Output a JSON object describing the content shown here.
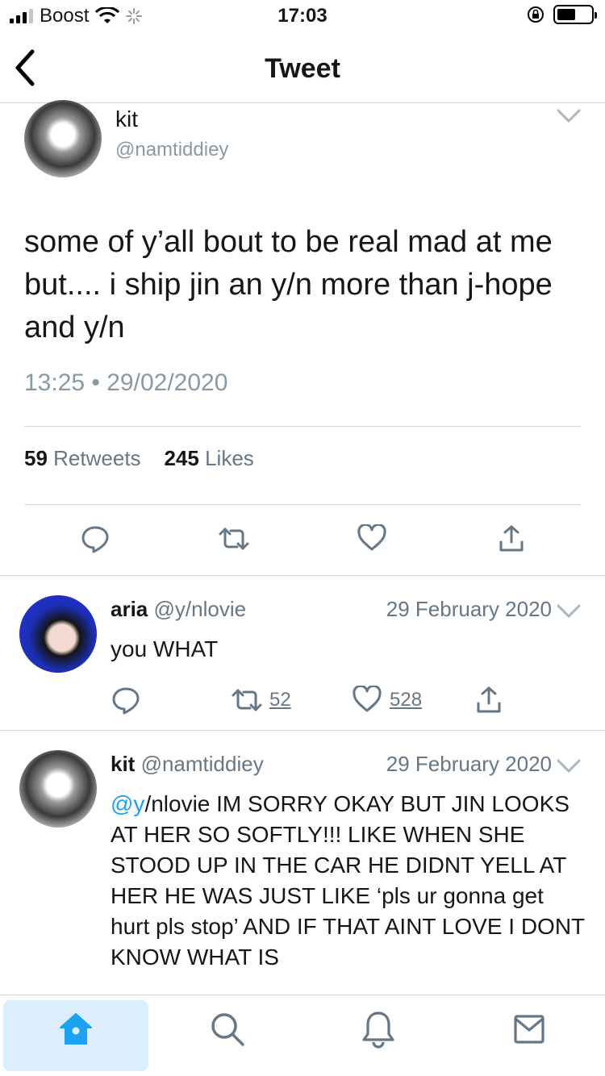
{
  "status_bar": {
    "carrier": "Boost",
    "time": "17:03"
  },
  "nav": {
    "title": "Tweet",
    "back_icon": "chevron-left-icon"
  },
  "main_tweet": {
    "author_name": "kit",
    "author_handle": "@namtiddiey",
    "text": "some of y’all bout to be real mad at me but.... i ship jin an y/n more than j-hope and y/n",
    "timestamp": "13:25 • 29/02/2020",
    "retweet_count": "59",
    "retweet_label": "Retweets",
    "like_count": "245",
    "like_label": "Likes"
  },
  "replies": [
    {
      "author_name": "aria",
      "author_handle": "@y/nlovie",
      "date": "29 February 2020",
      "text": "you WHAT",
      "retweets": "52",
      "likes": "528"
    },
    {
      "author_name": "kit",
      "author_handle": "@namtiddiey",
      "date": "29 February 2020",
      "mention": "@y",
      "text": "/nlovie IM SORRY OKAY BUT JIN LOOKS AT HER SO SOFTLY!!! LIKE WHEN SHE STOOD UP IN THE CAR HE DIDNT YELL AT HER HE WAS JUST LIKE ‘pls ur gonna get hurt pls stop’ AND IF THAT AINT LOVE I DONT KNOW WHAT IS"
    }
  ],
  "tab_bar": {
    "items": [
      "home-icon",
      "search-icon",
      "bell-icon",
      "mail-icon"
    ],
    "active": "home-icon"
  },
  "colors": {
    "accent": "#1da1f2",
    "secondary_text": "#657786",
    "icon_gray": "#657786"
  }
}
